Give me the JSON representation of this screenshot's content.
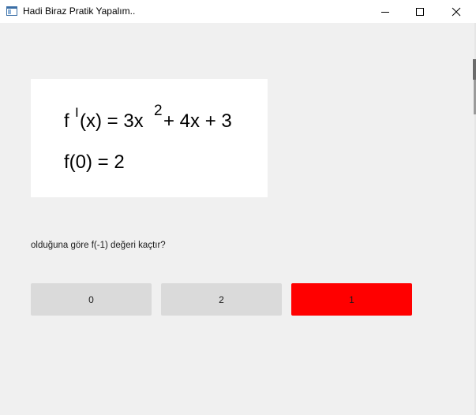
{
  "window": {
    "title": "Hadi Biraz Pratik Yapalım.."
  },
  "formula": {
    "line1_prefix": "f",
    "line1_prime": "I",
    "line1_mid": "(x) = 3x",
    "line1_exp": "2",
    "line1_tail": " + 4x + 3",
    "line2": "f(0) = 2"
  },
  "question": {
    "text": "olduğuna göre f(-1) değeri kaçtır?"
  },
  "answers": [
    {
      "label": "0",
      "color": "#dadada"
    },
    {
      "label": "2",
      "color": "#dadada"
    },
    {
      "label": "1",
      "color": "#ff0000"
    }
  ]
}
